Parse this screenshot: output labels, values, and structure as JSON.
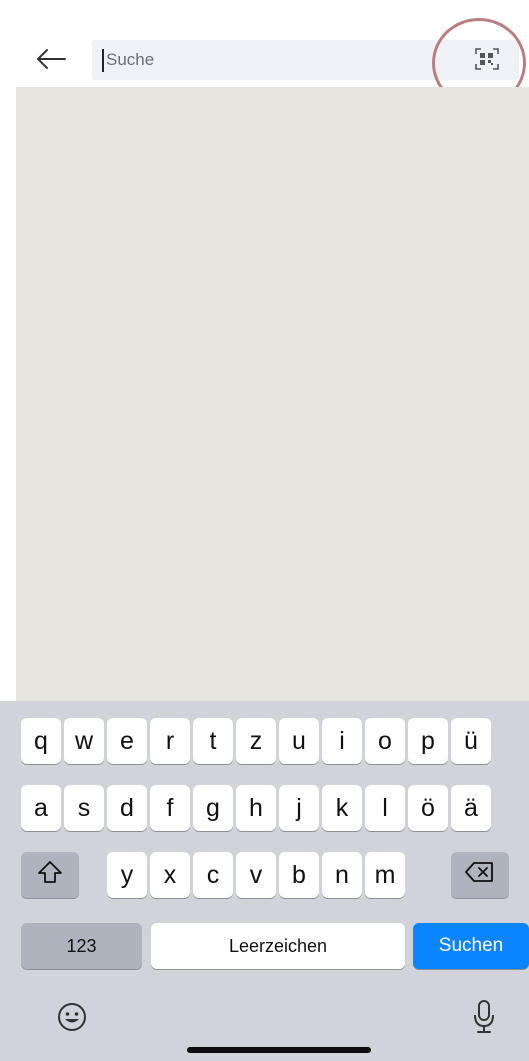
{
  "header": {
    "search": {
      "placeholder": "Suche",
      "value": ""
    }
  },
  "icons": {
    "back": "left-arrow-icon",
    "scan": "qr-scanner-icon",
    "emoji": "emoji-icon",
    "microphone": "microphone-icon",
    "shift": "shift-icon",
    "backspace": "backspace-icon"
  },
  "keyboard": {
    "row1": [
      "q",
      "w",
      "e",
      "r",
      "t",
      "z",
      "u",
      "i",
      "o",
      "p",
      "ü"
    ],
    "row2": [
      "a",
      "s",
      "d",
      "f",
      "g",
      "h",
      "j",
      "k",
      "l",
      "ö",
      "ä"
    ],
    "row3": [
      "y",
      "x",
      "c",
      "v",
      "b",
      "n",
      "m"
    ],
    "numbers_label": "123",
    "space_label": "Leerzeichen",
    "submit_label": "Suchen"
  },
  "colors": {
    "content_background": "#e7e5e0",
    "highlight_ring": "#b97f80",
    "submit_key": "#0a84ff",
    "keyboard_background": "#d0d3da"
  }
}
